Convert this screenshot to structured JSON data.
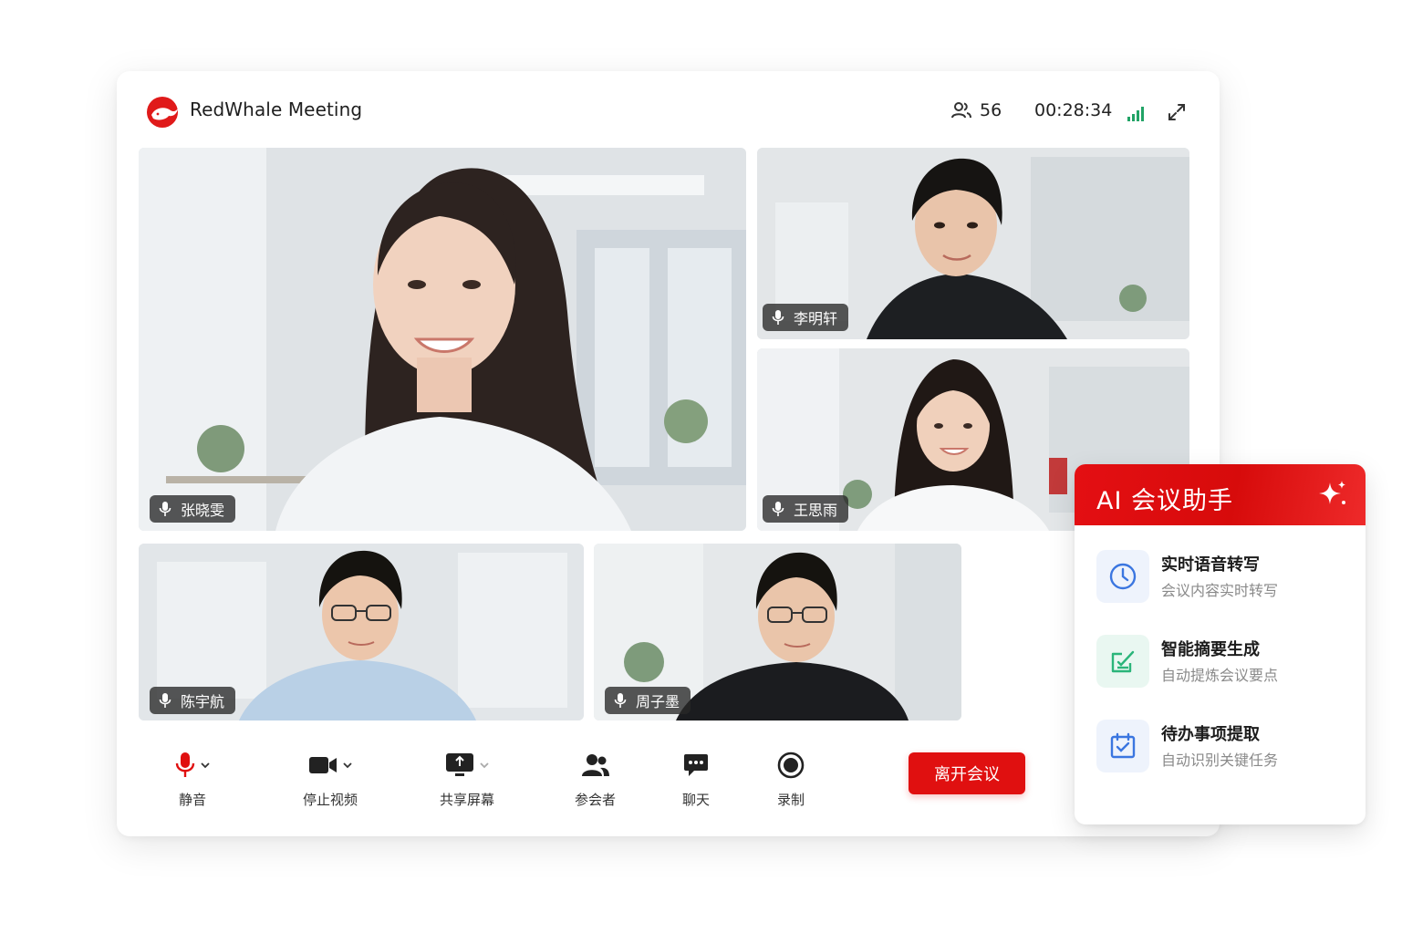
{
  "app": {
    "title": "RedWhale Meeting"
  },
  "header": {
    "participant_count": "56",
    "elapsed_time": "00:28:34",
    "icons": [
      "people-icon",
      "signal-strength-icon",
      "fullscreen-icon"
    ]
  },
  "participants": [
    {
      "name": "张晓雯",
      "mic": "on",
      "role": "main-speaker"
    },
    {
      "name": "李明轩",
      "mic": "on"
    },
    {
      "name": "王思雨",
      "mic": "on"
    },
    {
      "name": "陈宇航",
      "mic": "on"
    },
    {
      "name": "周子墨",
      "mic": "on"
    }
  ],
  "toolbar": {
    "mute": "静音",
    "stop_video": "停止视频",
    "share_screen": "共享屏幕",
    "participants": "参会者",
    "chat": "聊天",
    "record": "录制",
    "leave": "离开会议"
  },
  "ai_panel": {
    "title": "AI 会议助手",
    "items": [
      {
        "title": "实时语音转写",
        "subtitle": "会议内容实时转写",
        "icon": "clock-icon"
      },
      {
        "title": "智能摘要生成",
        "subtitle": "自动提炼会议要点",
        "icon": "edit-summary-icon"
      },
      {
        "title": "待办事项提取",
        "subtitle": "自动识别关键任务",
        "icon": "calendar-check-icon"
      }
    ]
  },
  "colors": {
    "brand_red": "#e01010",
    "signal_green": "#21a366",
    "ai_icon_blue_bg": "#eef3fc",
    "ai_icon_green_bg": "#e9f7f1"
  }
}
